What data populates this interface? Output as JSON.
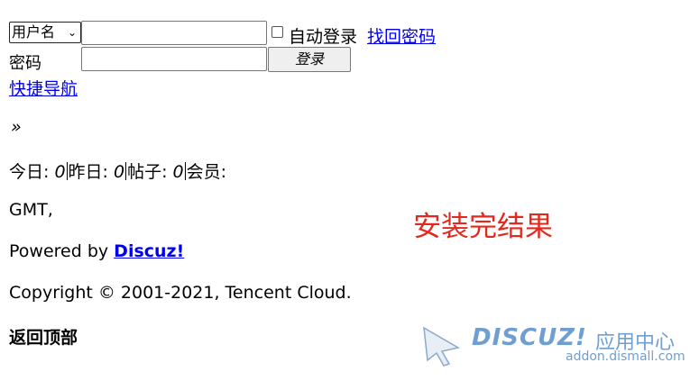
{
  "login": {
    "username_select": "用户名",
    "username_value": "",
    "autologin_label": "自动登录",
    "forgot_link": "找回密码",
    "password_label": "密码",
    "password_value": "",
    "login_button": "登录"
  },
  "nav": {
    "quick_nav": "快捷导航",
    "breadcrumb": "»"
  },
  "stats": {
    "today_label": "今日: ",
    "today_value": "0",
    "yesterday_label": "昨日: ",
    "yesterday_value": "0",
    "posts_label": "帖子: ",
    "posts_value": "0",
    "members_label": "会员:"
  },
  "footer": {
    "timezone": "GMT,",
    "powered_prefix": "Powered by ",
    "powered_link": "Discuz!",
    "copyright": "Copyright © 2001-2021, Tencent Cloud.",
    "back_to_top": "返回顶部"
  },
  "caption": "安装完结果",
  "watermark": {
    "brand": "DISCUZ!",
    "label": "应用中心",
    "url": "addon.dismall.com"
  },
  "colors": {
    "link": "#0000ee",
    "caption": "#e3291e",
    "watermark": "#6f9fd2"
  }
}
